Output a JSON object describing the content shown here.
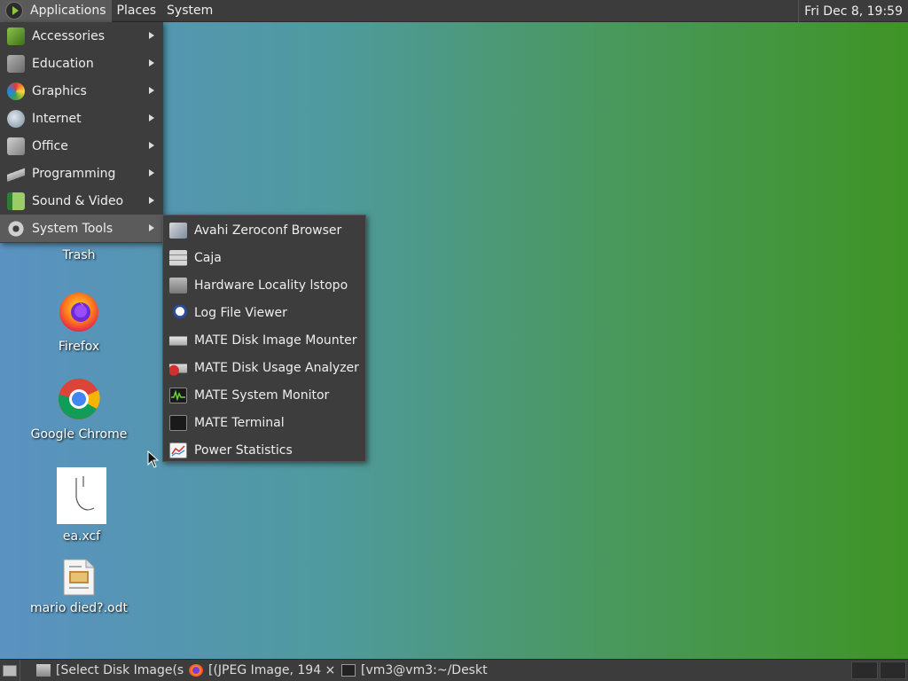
{
  "top_panel": {
    "menus": [
      "Applications",
      "Places",
      "System"
    ],
    "clock": "Fri Dec  8, 19:59"
  },
  "apps_menu": {
    "items": [
      {
        "label": "Accessories",
        "icon": "accessories-icon"
      },
      {
        "label": "Education",
        "icon": "education-icon"
      },
      {
        "label": "Graphics",
        "icon": "graphics-icon"
      },
      {
        "label": "Internet",
        "icon": "internet-icon"
      },
      {
        "label": "Office",
        "icon": "office-icon"
      },
      {
        "label": "Programming",
        "icon": "programming-icon"
      },
      {
        "label": "Sound & Video",
        "icon": "sound-video-icon"
      },
      {
        "label": "System Tools",
        "icon": "system-tools-icon"
      }
    ]
  },
  "system_tools_menu": {
    "items": [
      {
        "label": "Avahi Zeroconf Browser",
        "icon": "avahi-icon"
      },
      {
        "label": "Caja",
        "icon": "caja-icon"
      },
      {
        "label": "Hardware Locality lstopo",
        "icon": "lstopo-icon"
      },
      {
        "label": "Log File Viewer",
        "icon": "log-viewer-icon"
      },
      {
        "label": "MATE Disk Image Mounter",
        "icon": "disk-mounter-icon"
      },
      {
        "label": "MATE Disk Usage Analyzer",
        "icon": "disk-usage-icon"
      },
      {
        "label": "MATE System Monitor",
        "icon": "system-monitor-icon"
      },
      {
        "label": "MATE Terminal",
        "icon": "terminal-icon"
      },
      {
        "label": "Power Statistics",
        "icon": "power-stats-icon"
      }
    ]
  },
  "desktop": {
    "icons": [
      {
        "label": "Trash"
      },
      {
        "label": "Firefox"
      },
      {
        "label": "Google Chrome"
      },
      {
        "label": "ea.xcf"
      },
      {
        "label": "mario died?.odt"
      }
    ]
  },
  "taskbar": {
    "tasks": [
      {
        "label": "[Select Disk Image(s..."
      },
      {
        "label": "[(JPEG Image, 194 ×..."
      },
      {
        "label": "[vm3@vm3:~/Deskt..."
      }
    ]
  }
}
